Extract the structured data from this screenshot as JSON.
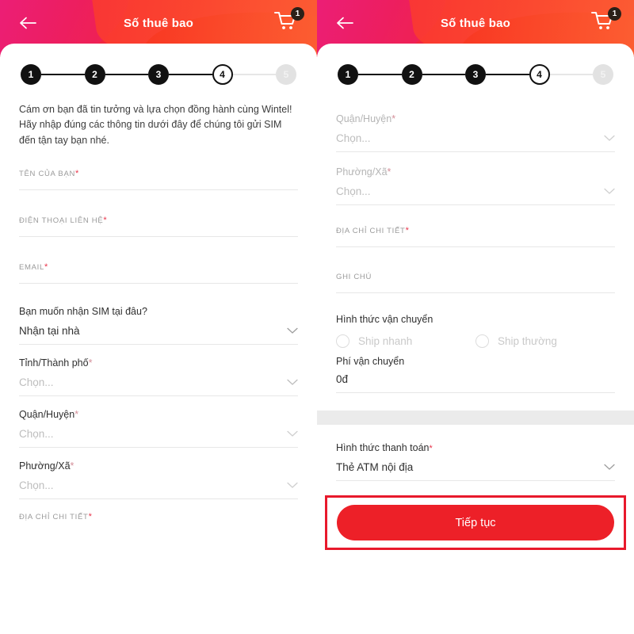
{
  "header": {
    "title": "Số thuê bao",
    "back_icon": "arrow-left-icon",
    "cart_icon": "shopping-cart-icon",
    "cart_badge": "1"
  },
  "stepper": {
    "steps": [
      {
        "label": "1",
        "state": "done"
      },
      {
        "label": "2",
        "state": "done"
      },
      {
        "label": "3",
        "state": "done"
      },
      {
        "label": "4",
        "state": "current"
      },
      {
        "label": "5",
        "state": "todo"
      }
    ]
  },
  "left": {
    "intro": "Cám ơn bạn đã tin tưởng và lựa chọn đồng hành cùng Wintel! Hãy nhập đúng các thông tin dưới đây để chúng tôi gửi SIM đến tận tay bạn nhé.",
    "name_label": "TÊN CỦA BẠN",
    "phone_label": "ĐIỆN THOẠI LIÊN HỆ",
    "email_label": "EMAIL",
    "delivery_question": "Bạn muốn nhận SIM tại đâu?",
    "delivery_value": "Nhận tại nhà",
    "province_label": "Tỉnh/Thành phố",
    "province_value": "Chọn...",
    "district_label": "Quận/Huyện",
    "district_value": "Chọn...",
    "ward_label": "Phường/Xã",
    "ward_value": "Chọn...",
    "address_label": "ĐỊA CHỈ CHI TIẾT",
    "required_mark": "*"
  },
  "right": {
    "district_label": "Quận/Huyện",
    "district_value": "Chọn...",
    "ward_label": "Phường/Xã",
    "ward_value": "Chọn...",
    "address_label": "ĐỊA CHỈ CHI TIẾT",
    "note_label": "GHI CHÚ",
    "shipping_title": "Hình thức vận chuyển",
    "shipping_fast": "Ship nhanh",
    "shipping_normal": "Ship thường",
    "fee_label": "Phí vận chuyển",
    "fee_value": "0đ",
    "payment_label": "Hình thức thanh toán",
    "payment_value": "Thẻ ATM nội địa",
    "cta_label": "Tiếp tục",
    "required_mark": "*"
  },
  "colors": {
    "brand_red": "#ed2028",
    "header_pink": "#f0206a",
    "header_orange": "#fd6333",
    "highlight_box": "#e8192c",
    "required": "#e8344a"
  }
}
